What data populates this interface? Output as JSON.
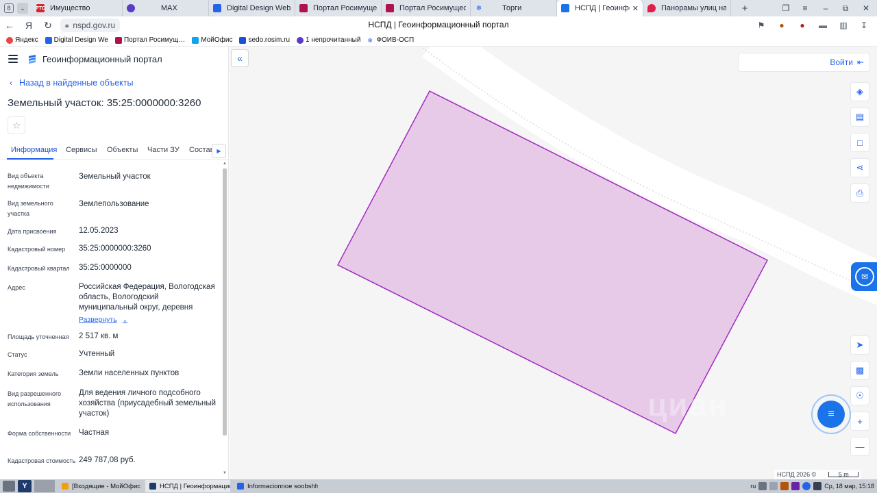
{
  "browser": {
    "tab_counter": "8",
    "tabs": [
      {
        "title": "Имущество",
        "favicon": "rts-icon",
        "color": "#d9252b",
        "active": false
      },
      {
        "title": "MAX",
        "favicon": "max-icon",
        "color": "#5b3cc4",
        "active": false
      },
      {
        "title": "Digital Design Web Client",
        "favicon": "document-icon",
        "color": "#2563eb",
        "active": false
      },
      {
        "title": "Портал Росимущества",
        "favicon": "rosim-icon",
        "color": "#b0124f",
        "active": false
      },
      {
        "title": "Портал Росимущества",
        "favicon": "rosim-icon",
        "color": "#b0124f",
        "active": false
      },
      {
        "title": "Торги",
        "favicon": "emblem-icon",
        "color": "#2563eb",
        "active": false
      },
      {
        "title": "НСПД | Геоинформационный",
        "favicon": "nspd-icon",
        "color": "#1a73e8",
        "active": true
      },
      {
        "title": "Панорамы улиц на карте",
        "favicon": "map-pin-icon",
        "color": "#e11d48",
        "active": false
      }
    ],
    "url": "nspd.gov.ru",
    "page_title": "НСПД | Геоинформационный портал",
    "bookmarks": [
      {
        "label": "Яндекс",
        "color": "#ef4444"
      },
      {
        "label": "Digital Design We",
        "color": "#2563eb"
      },
      {
        "label": "Портал Росимущ…",
        "color": "#b0124f"
      },
      {
        "label": "МойОфис",
        "color": "#0ea5e9"
      },
      {
        "label": "sedo.rosim.ru",
        "color": "#1d4ed8"
      },
      {
        "label": "1 непрочитанный",
        "color": "#5b3cc4"
      },
      {
        "label": "ФОИВ-ОСП",
        "color": "#2563eb"
      }
    ]
  },
  "portal": {
    "name": "Геоинформационный портал",
    "back_label": "Назад в найденные объекты",
    "parcel_title": "Земельный участок: 35:25:0000000:3260",
    "tabs": [
      "Информация",
      "Сервисы",
      "Объекты",
      "Части ЗУ",
      "Состав"
    ],
    "active_tab": "Информация",
    "properties": [
      {
        "label": "Вид объекта недвижимости",
        "value": "Земельный участок"
      },
      {
        "label": "Вид земельного участка",
        "value": "Землепользование"
      },
      {
        "label": "Дата присвоения",
        "value": "12.05.2023"
      },
      {
        "label": "Кадастровый номер",
        "value": "35:25:0000000:3260"
      },
      {
        "label": "Кадастровый квартал",
        "value": "35:25:0000000"
      },
      {
        "label": "Адрес",
        "value": "Российская Федерация, Вологодская область, Вологодский муниципальный округ, деревня"
      },
      {
        "label": "Площадь уточненная",
        "value": "2 517 кв. м"
      },
      {
        "label": "Статус",
        "value": "Учтенный"
      },
      {
        "label": "Категория земель",
        "value": "Земли населенных пунктов"
      },
      {
        "label": "Вид разрешенного использования",
        "value": "Для ведения личного подсобного хозяйства (приусадебный земельный участок)"
      },
      {
        "label": "Форма собственности",
        "value": "Частная"
      },
      {
        "label": "Кадастровая стоимость",
        "value": "249 787,08 руб."
      }
    ],
    "expand_label": "Развернуть"
  },
  "map": {
    "login_label": "Войти",
    "footer_brand": "НСПД 2026 ©",
    "scale_label": "5 m",
    "parcel_fill": "#e6c8e8",
    "parcel_stroke": "#a020c0",
    "road_color": "#ffffff",
    "watermark": "циан",
    "tools": [
      "layers-icon",
      "ruler-icon",
      "select-area-icon",
      "share-icon",
      "print-icon",
      "navigate-icon",
      "picture-in-picture-icon",
      "locate-icon",
      "zoom-in-icon",
      "zoom-out-icon"
    ]
  },
  "taskbar": {
    "tasks": [
      {
        "label": "[Входящие - МойОфис П...",
        "color": "#f59e0b",
        "active": false
      },
      {
        "label": "НСПД | Геоинформацио...",
        "color": "#1f3b6b",
        "active": true
      },
      {
        "label": "Informacionnoe soobshhe...",
        "color": "#2563eb",
        "active": false
      }
    ],
    "lang": "ru",
    "clock": "Ср, 18 мар, 15:18"
  }
}
